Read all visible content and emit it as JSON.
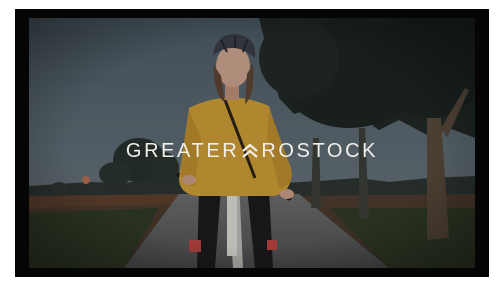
{
  "video": {
    "brand_left": "GREATER",
    "brand_right": "ROSTOCK",
    "logo_icon": "double-chevron-up-icon",
    "brand_color": "#f2efe8",
    "frame_color": "#050505"
  }
}
